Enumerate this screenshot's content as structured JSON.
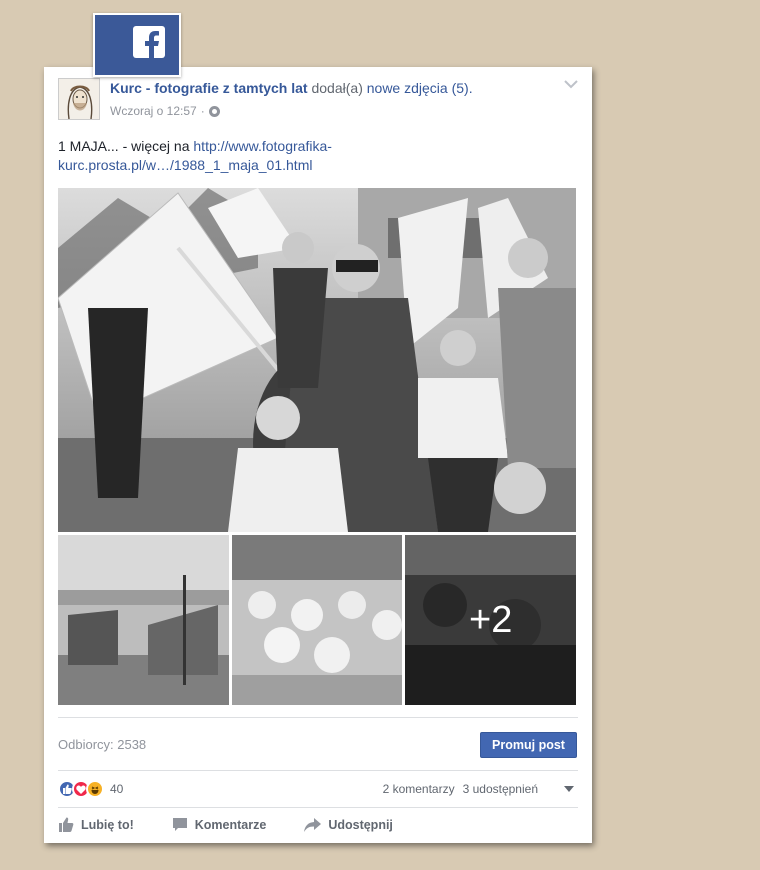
{
  "post": {
    "page_name": "Kurc - fotografie z tamtych lat",
    "action_prefix": "dodał(a)",
    "action_suffix": "nowe zdjęcia (5).",
    "timestamp": "Wczoraj o 12:57",
    "separator": "·",
    "text_before_link": "1 MAJA... - więcej na ",
    "link_text": "http://www.fotografika-kurc.prosta.pl/w…/1988_1_maja_01.html",
    "more_photos_label": "+2",
    "reach_label": "Odbiorcy: 2538",
    "promote_label": "Promuj post",
    "reactions_count": "40",
    "comments_label": "2 komentarzy",
    "shares_label": "3 udostępnień"
  },
  "actions": {
    "like": "Lubię to!",
    "comment": "Komentarze",
    "share": "Udostępnij"
  },
  "icons": {
    "facebook": "facebook-logo-icon",
    "globe": "globe-icon",
    "like": "thumbs-up-icon",
    "comment": "speech-bubble-icon",
    "share": "share-arrow-icon"
  },
  "colors": {
    "facebook_blue": "#3b5998",
    "link_blue": "#365899",
    "button_blue": "#4267b2",
    "background": "#d8cab3"
  }
}
